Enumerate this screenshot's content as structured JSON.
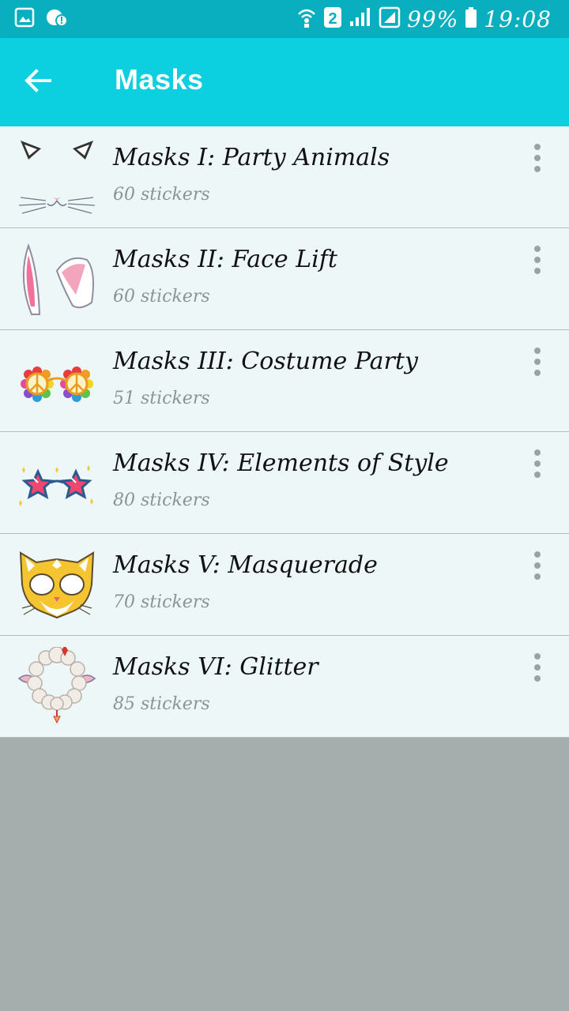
{
  "status_bar": {
    "sim_badge": "2",
    "battery": "99%",
    "time": "19:08"
  },
  "app_bar": {
    "title": "Masks",
    "back_icon": "arrow-left-icon"
  },
  "packs": [
    {
      "name": "Masks I: Party Animals",
      "count": "60 stickers",
      "thumbnail": "cat-ears-whiskers"
    },
    {
      "name": "Masks II: Face Lift",
      "count": "60 stickers",
      "thumbnail": "bunny-ears"
    },
    {
      "name": "Masks III: Costume Party",
      "count": "51 stickers",
      "thumbnail": "peace-sign-glasses"
    },
    {
      "name": "Masks IV: Elements of Style",
      "count": "80 stickers",
      "thumbnail": "star-glasses"
    },
    {
      "name": "Masks V: Masquerade",
      "count": "70 stickers",
      "thumbnail": "cat-mask"
    },
    {
      "name": "Masks VI: Glitter",
      "count": "85 stickers",
      "thumbnail": "sheep-mask"
    }
  ],
  "colors": {
    "status_bar": "#0aafbf",
    "app_bar": "#0ccfdf",
    "list_bg": "#eef7f8",
    "empty_bg": "#a5adad"
  }
}
